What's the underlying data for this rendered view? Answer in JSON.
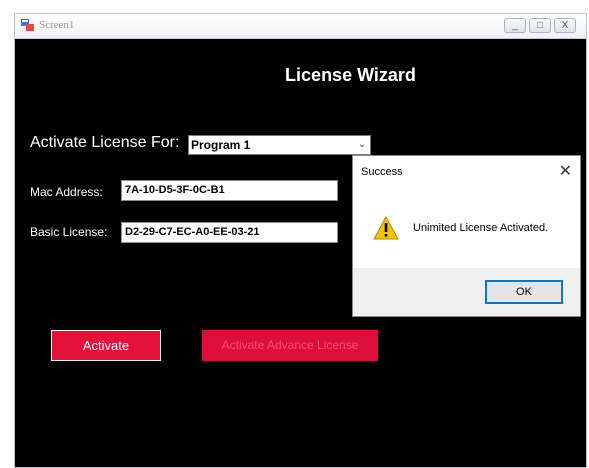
{
  "window": {
    "title": "Screen1",
    "controls": {
      "minimize": "_",
      "maximize": "□",
      "close": "X"
    }
  },
  "form": {
    "heading": "License Wizard",
    "activate_for_label": "Activate License For:",
    "program_select": {
      "value": "Program 1",
      "arrow": "⌄"
    },
    "mac_label": "Mac Address:",
    "mac_value": "7A-10-D5-3F-0C-B1",
    "basic_label": "Basic License:",
    "basic_value": "D2-29-C7-EC-A0-EE-03-21",
    "activate_button": "Activate",
    "advance_button": "Activate Advance License"
  },
  "dialog": {
    "title": "Success",
    "close": "✕",
    "icon": "warning-icon",
    "message": "Unimited License Activated.",
    "ok_button": "OK"
  },
  "colors": {
    "background": "#000000",
    "accent": "#e5113b",
    "dialog_footer": "#f0f0f0",
    "ok_border": "#0078d7",
    "warning": "#f5c400"
  }
}
